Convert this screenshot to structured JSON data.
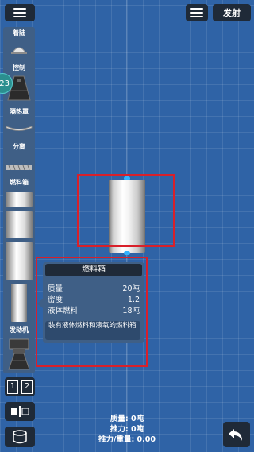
{
  "toolbar": {
    "launch_label": "发射"
  },
  "sidebar": {
    "categories": [
      "着陆",
      "控制",
      "隔热罩",
      "分离",
      "燃料箱",
      "发动机"
    ],
    "badge": "23"
  },
  "selected_part": {
    "name": "燃料箱"
  },
  "info_panel": {
    "title": "燃料箱",
    "rows": [
      {
        "label": "质量",
        "value": "20吨"
      },
      {
        "label": "密度",
        "value": "1.2"
      },
      {
        "label": "液体燃料",
        "value": "18吨"
      }
    ],
    "description": "装有液体燃料和液氧的燃料箱"
  },
  "bottom_buttons": {
    "stage_labels": [
      "1",
      "2"
    ]
  },
  "stats": {
    "mass_label": "质量: 0吨",
    "thrust_label": "推力: 0吨",
    "twr_label": "推力/重量: 0.00"
  },
  "colors": {
    "background": "#2f63a6",
    "panel": "#3f5f86",
    "button_dark": "#1f2a38",
    "highlight_red": "#d8202a",
    "node_blue": "#34b3ff"
  }
}
